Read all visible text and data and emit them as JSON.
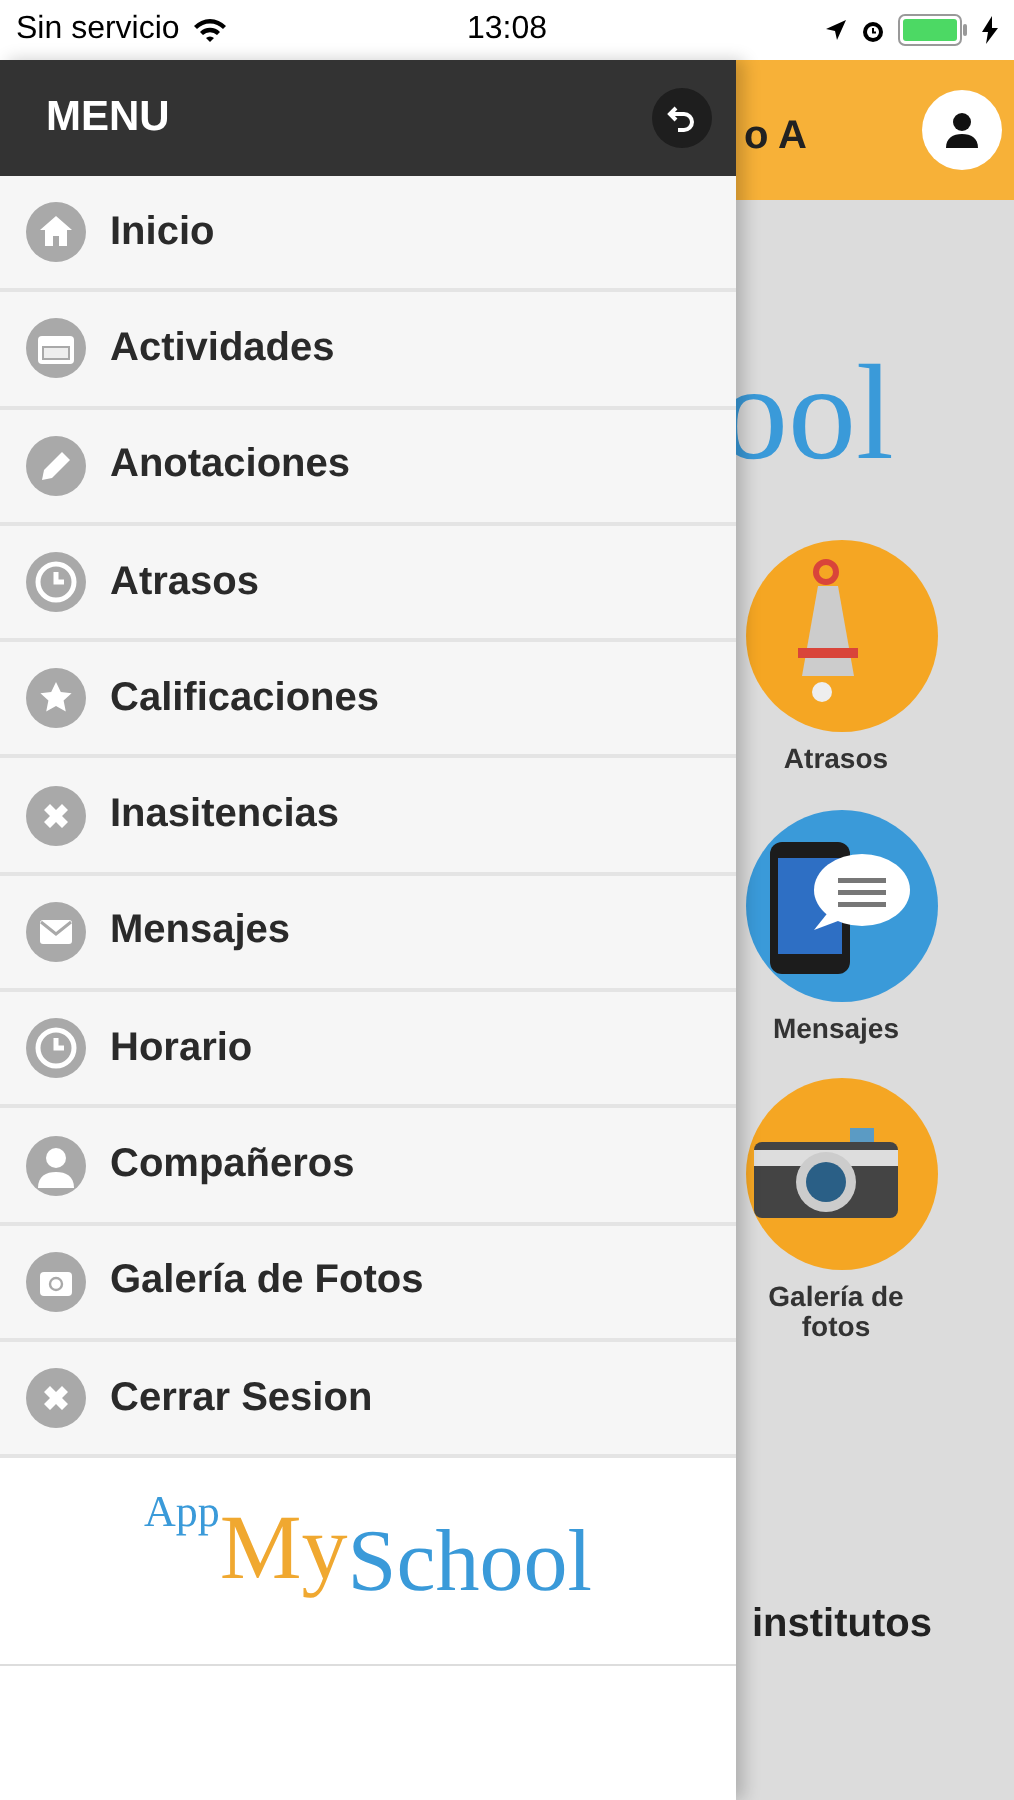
{
  "status_bar": {
    "carrier": "Sin servicio",
    "time": "13:08"
  },
  "background": {
    "title_fragment": "o A",
    "logo_fragment": "ool",
    "tiles": [
      {
        "label": "Atrasos"
      },
      {
        "label": "Mensajes"
      },
      {
        "label": "Galería de fotos"
      }
    ],
    "footer_fragment": "institutos"
  },
  "menu": {
    "title": "MENU",
    "items": [
      {
        "label": "Inicio"
      },
      {
        "label": "Actividades"
      },
      {
        "label": "Anotaciones"
      },
      {
        "label": "Atrasos"
      },
      {
        "label": "Calificaciones"
      },
      {
        "label": "Inasitencias"
      },
      {
        "label": "Mensajes"
      },
      {
        "label": "Horario"
      },
      {
        "label": "Compañeros"
      },
      {
        "label": "Galería de Fotos"
      },
      {
        "label": "Cerrar Sesion"
      }
    ],
    "logo": {
      "prefix": "App",
      "middle": "My",
      "suffix": "School"
    }
  }
}
